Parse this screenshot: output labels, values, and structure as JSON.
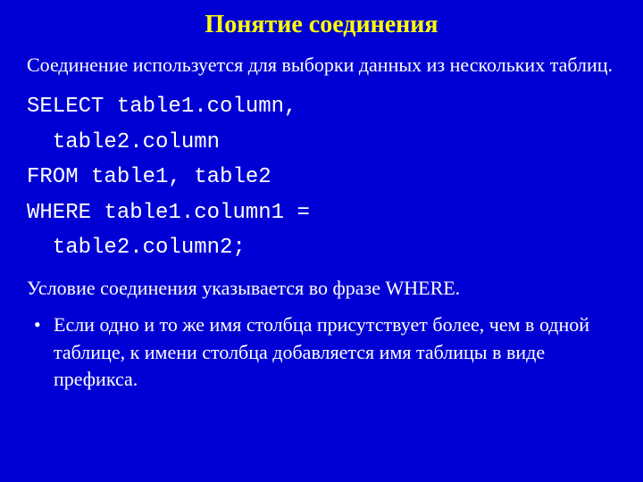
{
  "slide": {
    "title": "Понятие соединения",
    "intro": "Соединение используется для выборки данных из нескольких таблиц.",
    "code": "SELECT table1.column,\n  table2.column\nFROM table1, table2\nWHERE table1.column1 =\n  table2.column2;",
    "note": "Условие соединения указывается во фразе WHERE.",
    "bullets": [
      "Если одно и то же имя столбца присутствует более, чем в одной таблице, к имени столбца добавляется имя таблицы в виде префикса."
    ]
  }
}
